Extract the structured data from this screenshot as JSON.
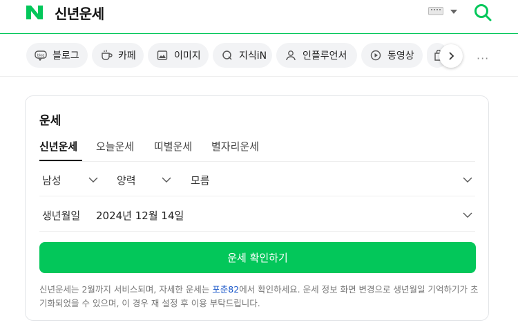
{
  "header": {
    "query": "신년운세",
    "logo_letter": "N",
    "brand_color": "#03c75a"
  },
  "tabs": [
    {
      "label": "블로그",
      "icon": "blog-icon"
    },
    {
      "label": "카페",
      "icon": "cafe-cup-icon"
    },
    {
      "label": "이미지",
      "icon": "image-icon"
    },
    {
      "label": "지식iN",
      "icon": "knowledge-q-icon"
    },
    {
      "label": "인플루언서",
      "icon": "person-icon"
    },
    {
      "label": "동영상",
      "icon": "play-icon"
    }
  ],
  "more_dots": "···",
  "card": {
    "title": "운세",
    "subtabs": [
      "신년운세",
      "오늘운세",
      "띠별운세",
      "별자리운세"
    ],
    "active_subtab": 0,
    "gender": "남성",
    "calendar": "양력",
    "time": "모름",
    "birth_label": "생년월일",
    "birth_value": "2024년 12월 14일",
    "cta": "운세 확인하기",
    "note_before": "신년운세는 2월까지 서비스되며, 자세한 운세는 ",
    "note_link": "포춘82",
    "note_after": "에서 확인하세요. 운세 정보 화면 변경으로 생년월일 기억하기가 초기화되었을 수 있으며, 이 경우 재 설정 후 이용 부탁드립니다."
  }
}
